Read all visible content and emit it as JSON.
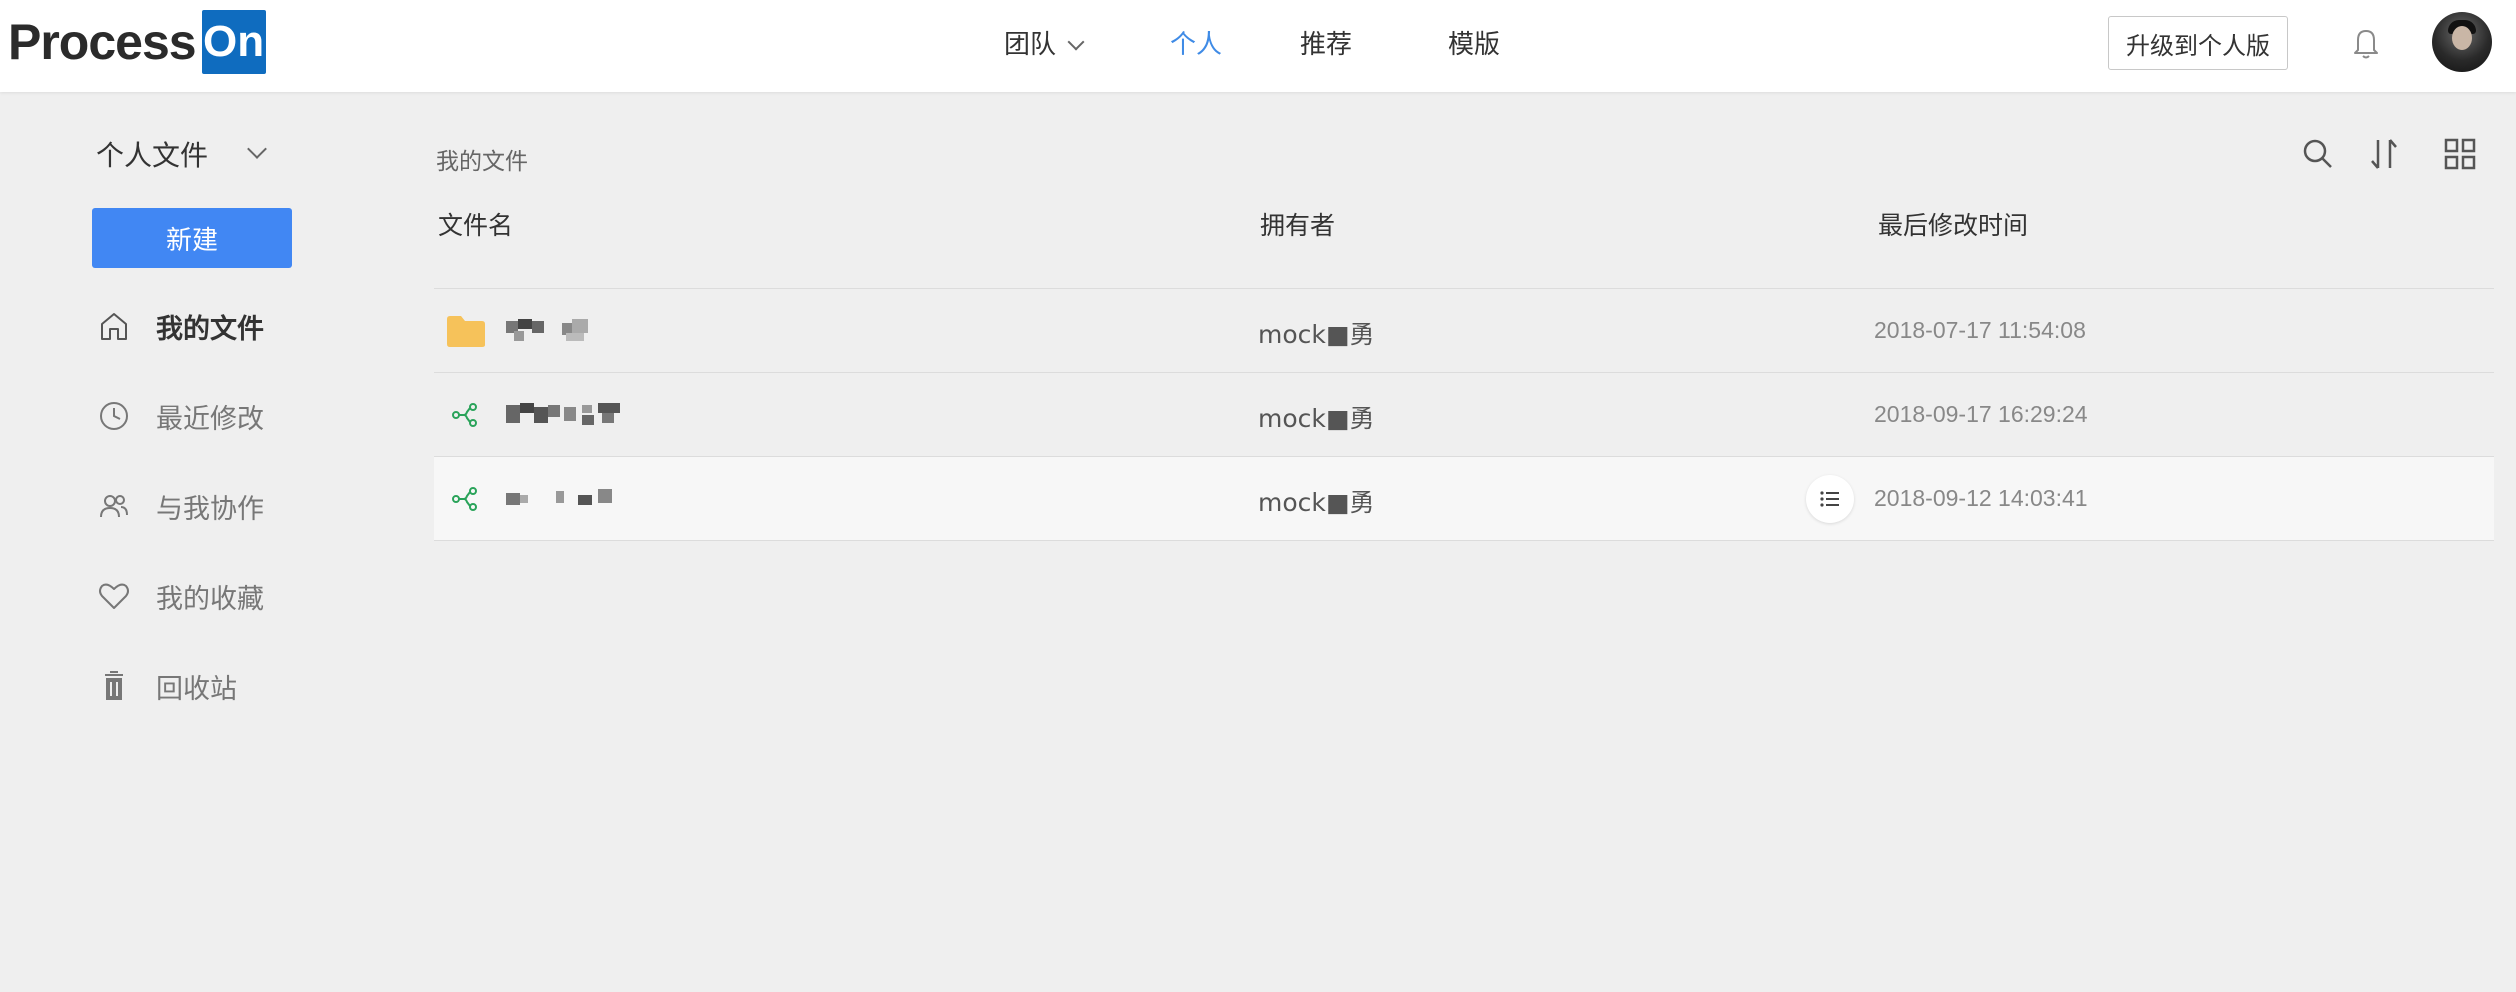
{
  "header": {
    "logo_text": "Process",
    "logo_badge": "On",
    "nav": [
      {
        "label": "团队",
        "has_dropdown": true
      },
      {
        "label": "个人",
        "active": true
      },
      {
        "label": "推荐"
      },
      {
        "label": "模版"
      }
    ],
    "upgrade_label": "升级到个人版",
    "bell_icon": "bell-icon",
    "accent_color": "#3f8be6"
  },
  "sidebar": {
    "section_label": "个人文件",
    "new_label": "新建",
    "new_color": "#4187f3",
    "items": [
      {
        "label": "我的文件",
        "icon": "home-icon",
        "active": true
      },
      {
        "label": "最近修改",
        "icon": "clock-icon"
      },
      {
        "label": "与我协作",
        "icon": "users-icon"
      },
      {
        "label": "我的收藏",
        "icon": "heart-icon"
      },
      {
        "label": "回收站",
        "icon": "trash-icon"
      }
    ]
  },
  "main": {
    "breadcrumb": "我的文件",
    "tools": [
      "search-icon",
      "sort-icon",
      "grid-view-icon"
    ],
    "columns": [
      "文件名",
      "拥有者",
      "最后修改时间"
    ],
    "rows": [
      {
        "type": "folder",
        "icon": "folder-icon",
        "owner": "mock■勇",
        "modified": "2018-07-17 11:54:08"
      },
      {
        "type": "mindmap",
        "icon": "mindmap-icon",
        "owner": "mock■勇",
        "modified": "2018-09-17 16:29:24"
      },
      {
        "type": "mindmap",
        "icon": "mindmap-icon",
        "owner": "mock■勇",
        "modified": "2018-09-12 14:03:41",
        "hovered": true
      }
    ]
  }
}
